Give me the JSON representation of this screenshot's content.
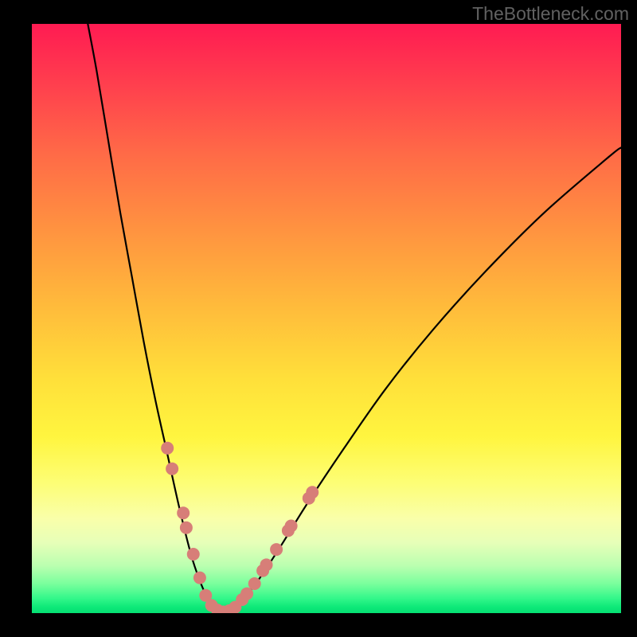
{
  "watermark": "TheBottleneck.com",
  "chart_data": {
    "type": "line",
    "title": "",
    "xlabel": "",
    "ylabel": "",
    "xlim": [
      0,
      100
    ],
    "ylim": [
      0,
      100
    ],
    "gradient_stops": [
      {
        "offset": 0,
        "color": "#ff1b52"
      },
      {
        "offset": 10,
        "color": "#ff3e4e"
      },
      {
        "offset": 22,
        "color": "#ff6a47"
      },
      {
        "offset": 35,
        "color": "#ff9340"
      },
      {
        "offset": 48,
        "color": "#ffbb3b"
      },
      {
        "offset": 60,
        "color": "#ffdf3a"
      },
      {
        "offset": 70,
        "color": "#fff53f"
      },
      {
        "offset": 78,
        "color": "#fdfe76"
      },
      {
        "offset": 84,
        "color": "#f9ffaa"
      },
      {
        "offset": 88,
        "color": "#e7ffb8"
      },
      {
        "offset": 92,
        "color": "#baffb0"
      },
      {
        "offset": 95,
        "color": "#7aff9d"
      },
      {
        "offset": 97.5,
        "color": "#33f78a"
      },
      {
        "offset": 99,
        "color": "#0de878"
      },
      {
        "offset": 100,
        "color": "#06df73"
      }
    ],
    "series": [
      {
        "name": "left-branch",
        "x": [
          9.5,
          11,
          13,
          15,
          17,
          19,
          21,
          23,
          25,
          27,
          28.5,
          30
        ],
        "y": [
          100,
          92,
          80,
          68,
          57,
          46,
          36,
          27,
          18,
          10,
          5.5,
          2
        ]
      },
      {
        "name": "valley",
        "x": [
          30,
          31,
          32,
          33,
          34,
          35
        ],
        "y": [
          2,
          0.8,
          0.2,
          0.2,
          0.7,
          1.6
        ]
      },
      {
        "name": "right-branch",
        "x": [
          35,
          38,
          42,
          47,
          53,
          60,
          68,
          77,
          87,
          98,
          100
        ],
        "y": [
          1.6,
          5,
          11,
          19,
          28,
          38,
          48,
          58,
          68,
          77.5,
          79
        ]
      }
    ],
    "markers": {
      "name": "highlight-points",
      "color": "#d77e78",
      "radius_px": 8,
      "points": [
        {
          "x": 23.0,
          "y": 28.0
        },
        {
          "x": 23.8,
          "y": 24.5
        },
        {
          "x": 25.7,
          "y": 17.0
        },
        {
          "x": 26.2,
          "y": 14.5
        },
        {
          "x": 27.4,
          "y": 10.0
        },
        {
          "x": 28.5,
          "y": 6.0
        },
        {
          "x": 29.5,
          "y": 3.0
        },
        {
          "x": 30.5,
          "y": 1.3
        },
        {
          "x": 31.5,
          "y": 0.5
        },
        {
          "x": 32.5,
          "y": 0.2
        },
        {
          "x": 33.5,
          "y": 0.4
        },
        {
          "x": 34.5,
          "y": 1.0
        },
        {
          "x": 35.7,
          "y": 2.3
        },
        {
          "x": 36.5,
          "y": 3.3
        },
        {
          "x": 37.8,
          "y": 5.0
        },
        {
          "x": 39.2,
          "y": 7.2
        },
        {
          "x": 39.8,
          "y": 8.2
        },
        {
          "x": 41.5,
          "y": 10.8
        },
        {
          "x": 43.5,
          "y": 14.0
        },
        {
          "x": 44.0,
          "y": 14.8
        },
        {
          "x": 47.0,
          "y": 19.5
        },
        {
          "x": 47.6,
          "y": 20.5
        }
      ]
    }
  }
}
